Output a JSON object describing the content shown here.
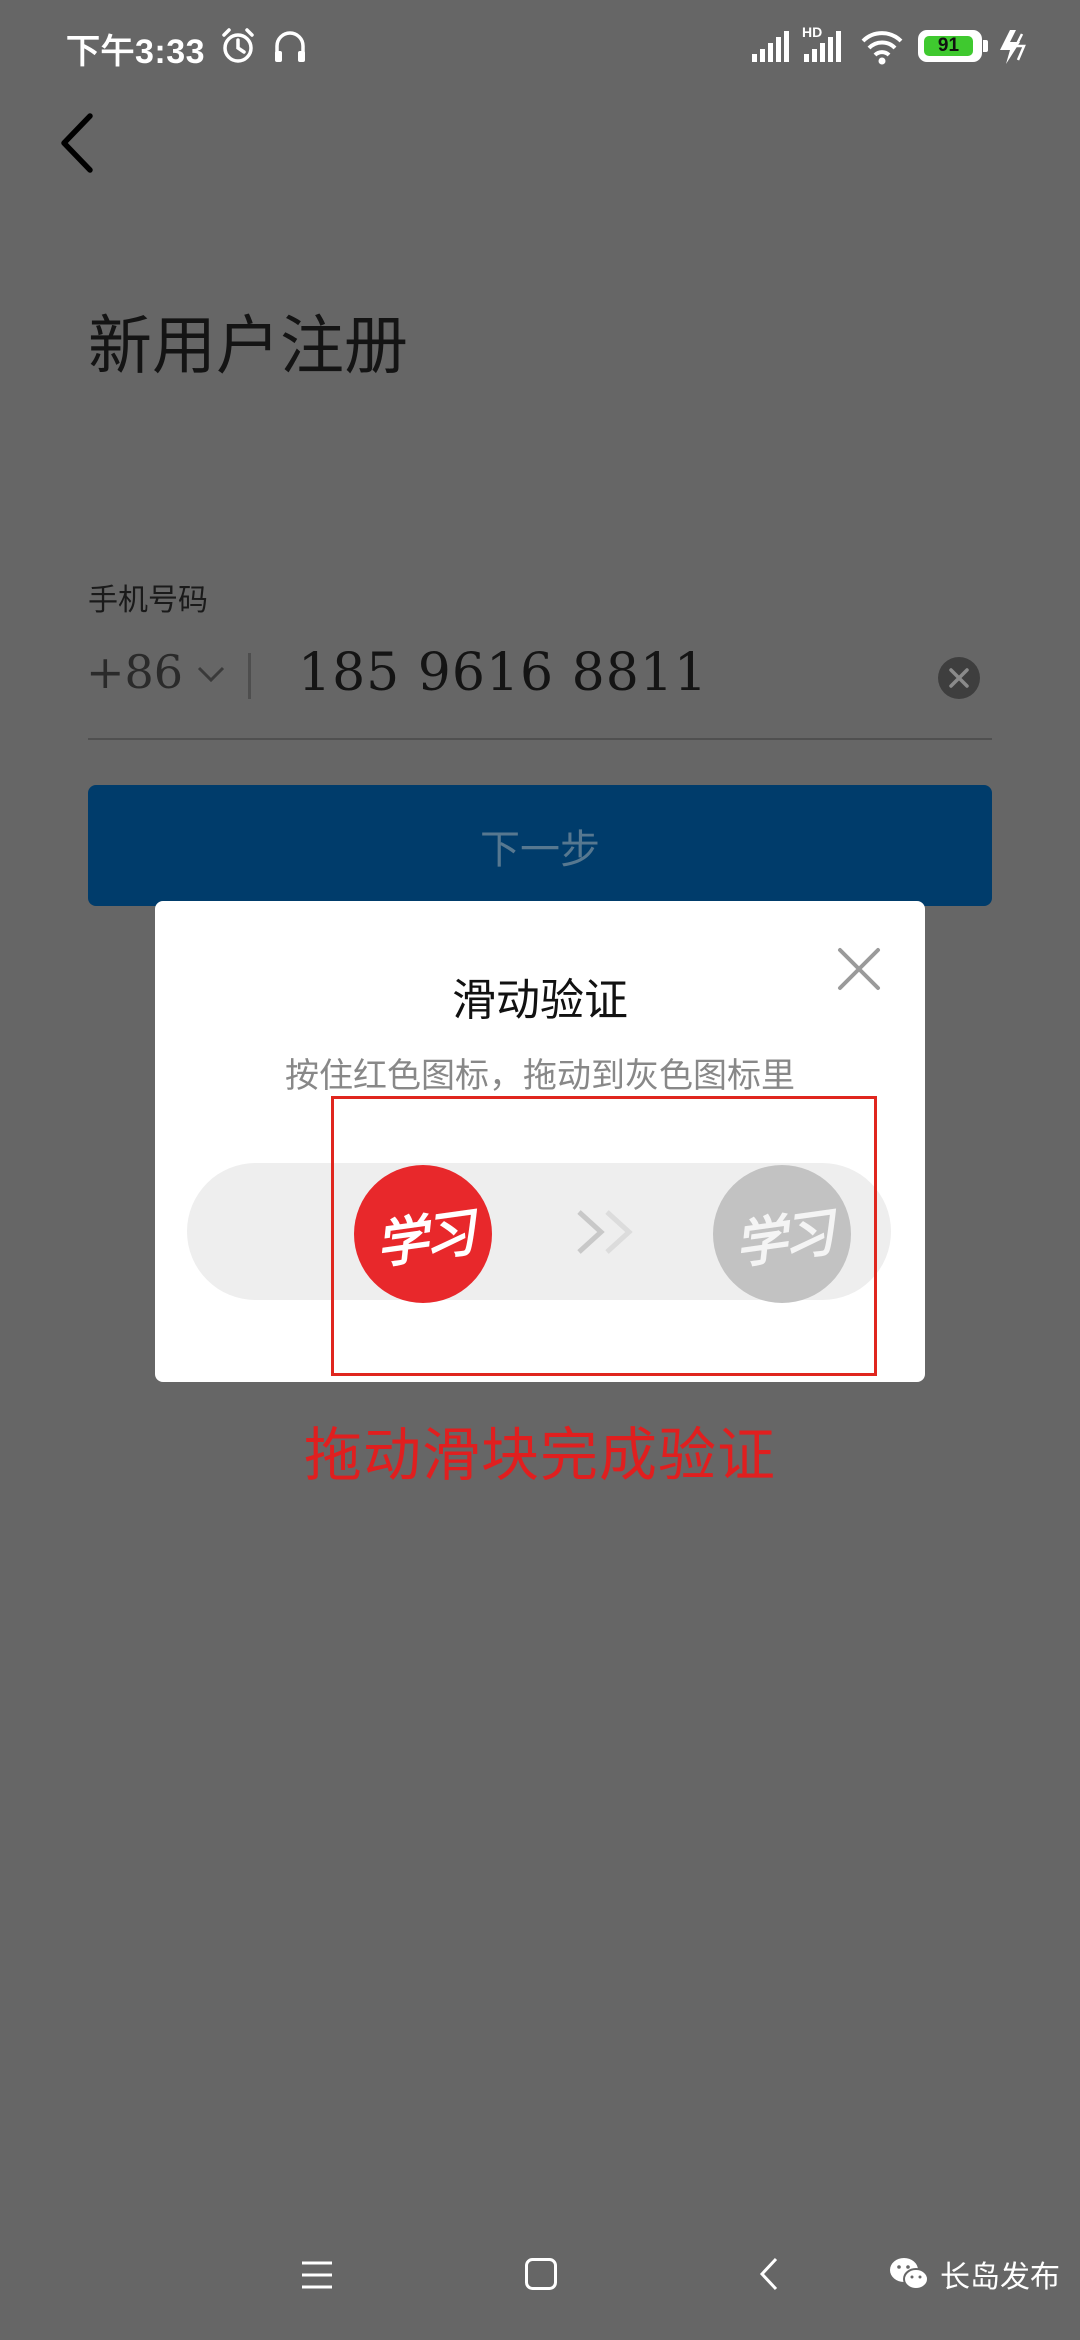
{
  "status_bar": {
    "time": "下午3:33",
    "network": "HD",
    "battery": "91",
    "icons": [
      "alarm-icon",
      "headset-icon",
      "signal-icon",
      "wifi-icon",
      "battery-icon",
      "charging-icon"
    ]
  },
  "page": {
    "title": "新用户注册",
    "phone_label": "手机号码",
    "country_code": "+86",
    "phone_value": "185 9616 8811",
    "next_label": "下一步"
  },
  "modal": {
    "title": "滑动验证",
    "subtitle": "按住红色图标，拖动到灰色图标里",
    "slider_logo": "学习",
    "target_logo": "学习",
    "arrows": ">>"
  },
  "annotation": {
    "text": "拖动滑块完成验证"
  },
  "watermark": {
    "text": "长岛发布"
  },
  "colors": {
    "overlay_background": "#666666",
    "primary_button": "#003c6b",
    "slider_knob": "#e8282b",
    "slider_target": "#c2c2c2",
    "annotation": "#e01f1f"
  }
}
